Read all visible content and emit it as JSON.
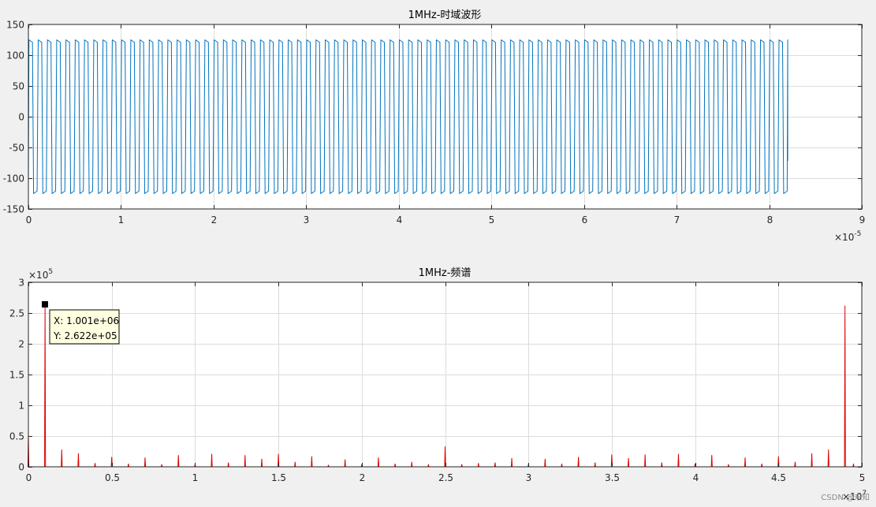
{
  "colors": {
    "figure_bg": "#f0f0f0",
    "axes_bg": "#ffffff",
    "grid": "#dcdcdc",
    "axis": "#262626",
    "time_line": "#0072bd",
    "spectrum_line": "#e00000"
  },
  "watermark": "CSDN @未知",
  "chart_data": [
    {
      "type": "line",
      "title": "1MHz-时域波形",
      "xlim": [
        0,
        9
      ],
      "ylim": [
        -150,
        150
      ],
      "grid": true,
      "x_multiplier": {
        "base": "×10",
        "exp": "-5"
      },
      "x_ticks": [
        0,
        1,
        2,
        3,
        4,
        5,
        6,
        7,
        8,
        9
      ],
      "x_tick_labels": [
        "0",
        "1",
        "2",
        "3",
        "4",
        "5",
        "6",
        "7",
        "8",
        "9"
      ],
      "y_ticks": [
        -150,
        -100,
        -50,
        0,
        50,
        100,
        150
      ],
      "y_tick_labels": [
        "-150",
        "-100",
        "-50",
        "0",
        "50",
        "100",
        "150"
      ],
      "series": [
        {
          "color": "#0072bd",
          "waveform": {
            "shape": "clipped-square-wave",
            "frequency_per_x_unit": 10,
            "high": 125,
            "low": -125,
            "duration": 8.2,
            "start_value": -120,
            "end_value": -72
          }
        }
      ]
    },
    {
      "type": "line",
      "title": "1MHz-频谱",
      "xlim": [
        0,
        5
      ],
      "ylim": [
        0,
        3
      ],
      "grid": true,
      "x_multiplier": {
        "base": "×10",
        "exp": "7"
      },
      "y_multiplier": {
        "base": "×10",
        "exp": "5"
      },
      "x_ticks": [
        0,
        0.5,
        1,
        1.5,
        2,
        2.5,
        3,
        3.5,
        4,
        4.5,
        5
      ],
      "x_tick_labels": [
        "0",
        "0.5",
        "1",
        "1.5",
        "2",
        "2.5",
        "3",
        "3.5",
        "4",
        "4.5",
        "5"
      ],
      "y_ticks": [
        0,
        0.5,
        1,
        1.5,
        2,
        2.5,
        3
      ],
      "y_tick_labels": [
        "0",
        "0.5",
        "1",
        "1.5",
        "2",
        "2.5",
        "3"
      ],
      "series": [
        {
          "color": "#e00000",
          "peaks": [
            [
              0.0,
              0.55
            ],
            [
              0.1,
              2.62
            ],
            [
              0.2,
              0.28
            ],
            [
              0.3,
              0.22
            ],
            [
              0.4,
              0.06
            ],
            [
              0.5,
              0.16
            ],
            [
              0.6,
              0.05
            ],
            [
              0.7,
              0.15
            ],
            [
              0.8,
              0.04
            ],
            [
              0.9,
              0.19
            ],
            [
              1.0,
              0.04
            ],
            [
              1.1,
              0.21
            ],
            [
              1.2,
              0.07
            ],
            [
              1.3,
              0.19
            ],
            [
              1.4,
              0.13
            ],
            [
              1.5,
              0.21
            ],
            [
              1.6,
              0.08
            ],
            [
              1.7,
              0.17
            ],
            [
              1.8,
              0.03
            ],
            [
              1.9,
              0.12
            ],
            [
              2.0,
              0.04
            ],
            [
              2.1,
              0.15
            ],
            [
              2.2,
              0.05
            ],
            [
              2.3,
              0.08
            ],
            [
              2.4,
              0.04
            ],
            [
              2.5,
              0.33
            ],
            [
              2.6,
              0.04
            ],
            [
              2.7,
              0.06
            ],
            [
              2.8,
              0.07
            ],
            [
              2.9,
              0.14
            ],
            [
              3.0,
              0.04
            ],
            [
              3.1,
              0.13
            ],
            [
              3.2,
              0.05
            ],
            [
              3.3,
              0.16
            ],
            [
              3.4,
              0.07
            ],
            [
              3.5,
              0.2
            ],
            [
              3.6,
              0.14
            ],
            [
              3.7,
              0.2
            ],
            [
              3.8,
              0.07
            ],
            [
              3.9,
              0.21
            ],
            [
              4.0,
              0.05
            ],
            [
              4.1,
              0.19
            ],
            [
              4.2,
              0.04
            ],
            [
              4.3,
              0.15
            ],
            [
              4.4,
              0.05
            ],
            [
              4.5,
              0.17
            ],
            [
              4.6,
              0.08
            ],
            [
              4.7,
              0.22
            ],
            [
              4.8,
              0.28
            ],
            [
              4.899,
              2.62
            ],
            [
              4.95,
              0.05
            ]
          ]
        }
      ],
      "datatip": {
        "x": 0.1001,
        "y": 2.622,
        "lines": [
          "X: 1.001e+06",
          "Y: 2.622e+05"
        ]
      }
    }
  ]
}
